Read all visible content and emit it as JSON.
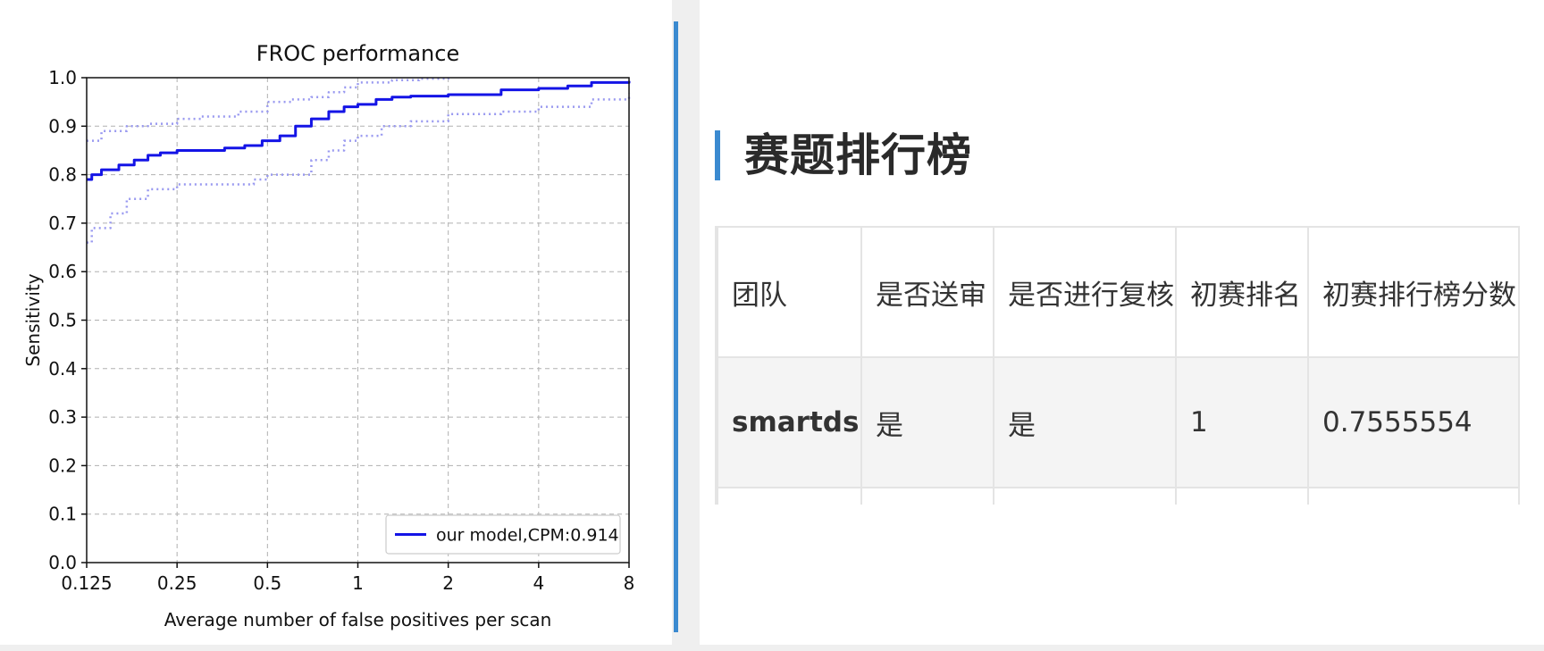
{
  "chart_data": {
    "type": "line",
    "title": "FROC performance",
    "xlabel": "Average number of false positives per scan",
    "ylabel": "Sensitivity",
    "x_scale": "log2",
    "xlim": [
      0.125,
      8
    ],
    "ylim": [
      0,
      1
    ],
    "x_ticks": [
      0.125,
      0.25,
      0.5,
      1,
      2,
      4,
      8
    ],
    "x_tick_labels": [
      "0.125",
      "0.25",
      "0.5",
      "1",
      "2",
      "4",
      "8"
    ],
    "y_ticks": [
      0,
      0.1,
      0.2,
      0.3,
      0.4,
      0.5,
      0.6,
      0.7,
      0.8,
      0.9,
      1.0
    ],
    "y_tick_labels": [
      "0.0",
      "0.1",
      "0.2",
      "0.3",
      "0.4",
      "0.5",
      "0.6",
      "0.7",
      "0.8",
      "0.9",
      "1.0"
    ],
    "grid": true,
    "legend_position": "bottom-right",
    "series": [
      {
        "name": "our model,CPM:0.914",
        "style": "solid",
        "color": "#1414e6",
        "x": [
          0.125,
          0.13,
          0.14,
          0.16,
          0.18,
          0.2,
          0.22,
          0.25,
          0.3,
          0.36,
          0.42,
          0.48,
          0.55,
          0.62,
          0.7,
          0.8,
          0.9,
          1.0,
          1.15,
          1.3,
          1.5,
          2.0,
          3.0,
          4.0,
          5.0,
          6.0,
          8.0
        ],
        "y": [
          0.79,
          0.8,
          0.81,
          0.82,
          0.83,
          0.84,
          0.845,
          0.85,
          0.85,
          0.855,
          0.86,
          0.87,
          0.88,
          0.9,
          0.915,
          0.93,
          0.94,
          0.945,
          0.955,
          0.96,
          0.962,
          0.965,
          0.975,
          0.978,
          0.983,
          0.99,
          0.993
        ]
      },
      {
        "style": "dotted",
        "color": "#9999f0",
        "x": [
          0.125,
          0.14,
          0.17,
          0.2,
          0.25,
          0.3,
          0.4,
          0.5,
          0.6,
          0.7,
          0.8,
          0.9,
          1.0,
          1.3,
          1.6,
          2.0
        ],
        "y": [
          0.87,
          0.89,
          0.9,
          0.905,
          0.915,
          0.92,
          0.93,
          0.95,
          0.955,
          0.96,
          0.97,
          0.98,
          0.99,
          0.995,
          0.998,
          1.0
        ]
      },
      {
        "style": "dotted",
        "color": "#9999f0",
        "x": [
          0.125,
          0.13,
          0.15,
          0.17,
          0.2,
          0.25,
          0.35,
          0.45,
          0.5,
          0.6,
          0.7,
          0.8,
          0.9,
          1.0,
          1.2,
          1.5,
          2.0,
          3.0,
          4.0,
          6.0,
          8.0
        ],
        "y": [
          0.66,
          0.69,
          0.72,
          0.75,
          0.77,
          0.78,
          0.78,
          0.79,
          0.8,
          0.8,
          0.83,
          0.85,
          0.87,
          0.88,
          0.9,
          0.91,
          0.925,
          0.93,
          0.94,
          0.955,
          0.968
        ]
      }
    ]
  },
  "leaderboard": {
    "heading": "赛题排行榜",
    "columns": [
      "团队",
      "是否送审",
      "是否进行复核",
      "初赛排名",
      "初赛排行榜分数"
    ],
    "rows": [
      [
        "smartdsp",
        "是",
        "是",
        "1",
        "0.7555554"
      ]
    ]
  }
}
